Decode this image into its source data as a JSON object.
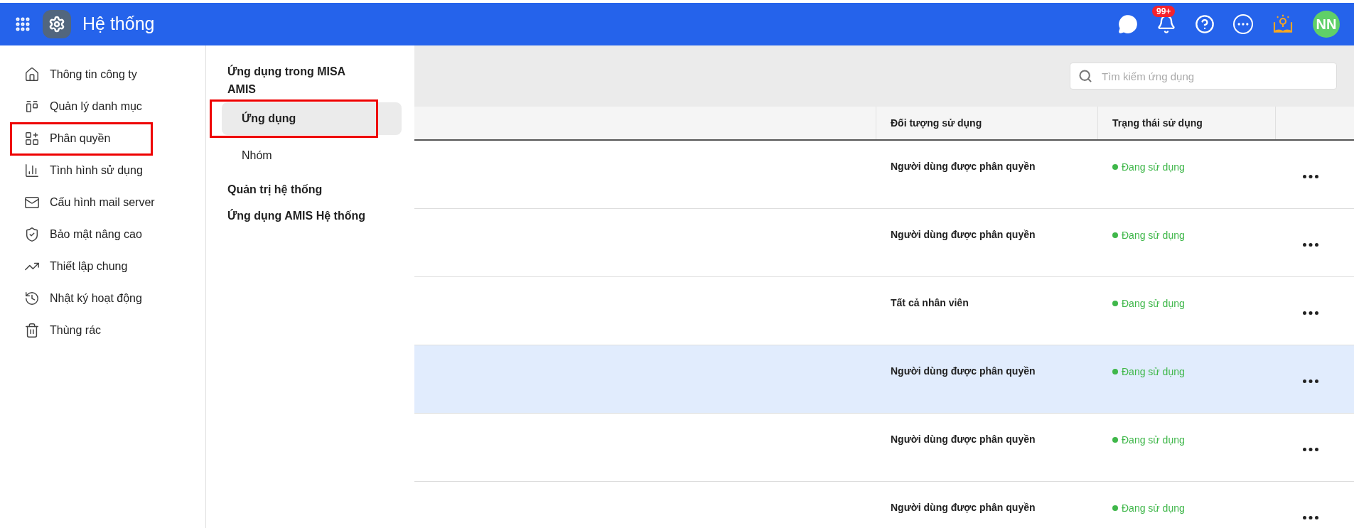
{
  "header": {
    "title": "Hệ thống",
    "notification_badge": "99+",
    "avatar": "NN"
  },
  "sidebar": {
    "items": [
      {
        "label": "Thông tin công ty",
        "annotated": false
      },
      {
        "label": "Quản lý danh mục",
        "annotated": false
      },
      {
        "label": "Phân quyền",
        "annotated": true
      },
      {
        "label": "Tình hình sử dụng",
        "annotated": false
      },
      {
        "label": "Cấu hình mail server",
        "annotated": false
      },
      {
        "label": "Bảo mật nâng cao",
        "annotated": false
      },
      {
        "label": "Thiết lập chung",
        "annotated": false
      },
      {
        "label": "Nhật ký hoạt động",
        "annotated": false
      },
      {
        "label": "Thùng rác",
        "annotated": false
      }
    ]
  },
  "submenu": {
    "groups": [
      {
        "label": "Ứng dụng trong MISA AMIS",
        "children": [
          {
            "label": "Ứng dụng",
            "selected": true,
            "annotated": true
          },
          {
            "label": "Nhóm",
            "selected": false,
            "annotated": false
          }
        ]
      },
      {
        "label": "Quản trị hệ thống"
      },
      {
        "label": "Ứng dụng AMIS Hệ thống"
      }
    ]
  },
  "search": {
    "placeholder": "Tìm kiếm ứng dụng"
  },
  "table": {
    "columns": [
      "Đối tượng sử dụng",
      "Trạng thái sử dụng"
    ],
    "rows": [
      {
        "audience": "Người dùng được phân quyền",
        "status": "Đang sử dụng",
        "selected": false
      },
      {
        "audience": "Người dùng được phân quyền",
        "status": "Đang sử dụng",
        "selected": false
      },
      {
        "audience": "Tất cả nhân viên",
        "status": "Đang sử dụng",
        "selected": false
      },
      {
        "audience": "Người dùng được phân quyền",
        "status": "Đang sử dụng",
        "selected": true
      },
      {
        "audience": "Người dùng được phân quyền",
        "status": "Đang sử dụng",
        "selected": false
      },
      {
        "audience": "Người dùng được phân quyền",
        "status": "Đang sử dụng",
        "selected": false
      }
    ]
  }
}
